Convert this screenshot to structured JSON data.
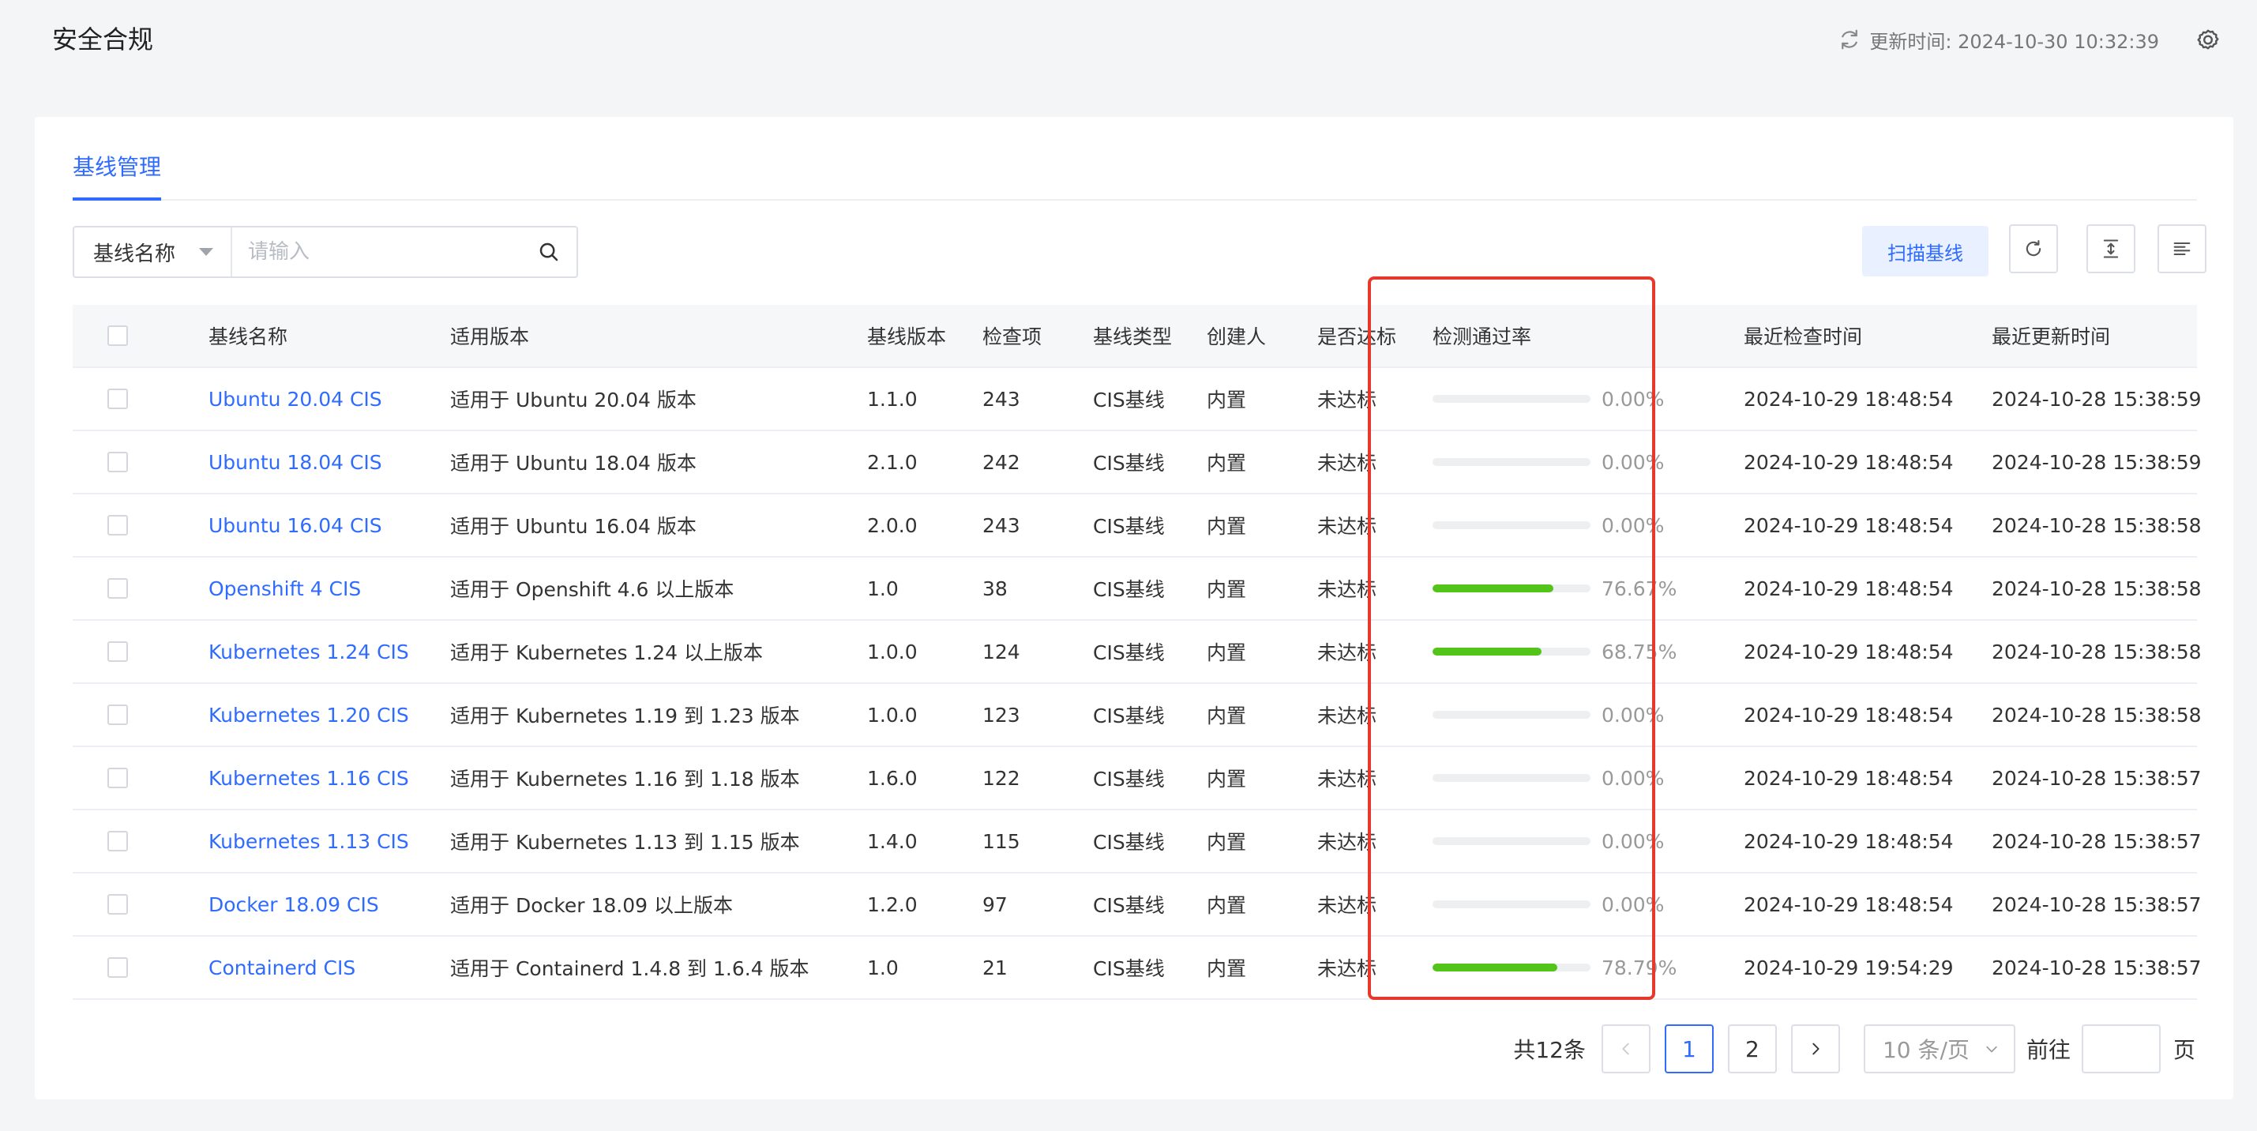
{
  "header": {
    "title": "安全合规",
    "update_time": "更新时间: 2024-10-30 10:32:39"
  },
  "tabs": [
    {
      "label": "基线管理",
      "active": true
    }
  ],
  "search": {
    "field": "基线名称",
    "placeholder": "请输入"
  },
  "toolbar": {
    "scan_label": "扫描基线"
  },
  "colors": {
    "accent": "#2f6bff",
    "progress": "#52c41a",
    "highlight": "#e8382c"
  },
  "table": {
    "columns": [
      "基线名称",
      "适用版本",
      "基线版本",
      "检查项",
      "基线类型",
      "创建人",
      "是否达标",
      "检测通过率",
      "最近检查时间",
      "最近更新时间"
    ],
    "rows": [
      {
        "name": "Ubuntu 20.04 CIS",
        "version": "适用于 Ubuntu 20.04 版本",
        "baseline_version": "1.1.0",
        "items": "243",
        "type": "CIS基线",
        "creator": "内置",
        "compliant": "未达标",
        "pass_rate": "0.00%",
        "pass_rate_value": 0.0,
        "last_check": "2024-10-29 18:48:54",
        "last_update": "2024-10-28 15:38:59"
      },
      {
        "name": "Ubuntu 18.04 CIS",
        "version": "适用于 Ubuntu 18.04 版本",
        "baseline_version": "2.1.0",
        "items": "242",
        "type": "CIS基线",
        "creator": "内置",
        "compliant": "未达标",
        "pass_rate": "0.00%",
        "pass_rate_value": 0.0,
        "last_check": "2024-10-29 18:48:54",
        "last_update": "2024-10-28 15:38:59"
      },
      {
        "name": "Ubuntu 16.04 CIS",
        "version": "适用于 Ubuntu 16.04 版本",
        "baseline_version": "2.0.0",
        "items": "243",
        "type": "CIS基线",
        "creator": "内置",
        "compliant": "未达标",
        "pass_rate": "0.00%",
        "pass_rate_value": 0.0,
        "last_check": "2024-10-29 18:48:54",
        "last_update": "2024-10-28 15:38:58"
      },
      {
        "name": "Openshift 4 CIS",
        "version": "适用于 Openshift 4.6 以上版本",
        "baseline_version": "1.0",
        "items": "38",
        "type": "CIS基线",
        "creator": "内置",
        "compliant": "未达标",
        "pass_rate": "76.67%",
        "pass_rate_value": 76.67,
        "last_check": "2024-10-29 18:48:54",
        "last_update": "2024-10-28 15:38:58"
      },
      {
        "name": "Kubernetes 1.24 CIS",
        "version": "适用于 Kubernetes 1.24 以上版本",
        "baseline_version": "1.0.0",
        "items": "124",
        "type": "CIS基线",
        "creator": "内置",
        "compliant": "未达标",
        "pass_rate": "68.75%",
        "pass_rate_value": 68.75,
        "last_check": "2024-10-29 18:48:54",
        "last_update": "2024-10-28 15:38:58"
      },
      {
        "name": "Kubernetes 1.20 CIS",
        "version": "适用于 Kubernetes 1.19 到 1.23 版本",
        "baseline_version": "1.0.0",
        "items": "123",
        "type": "CIS基线",
        "creator": "内置",
        "compliant": "未达标",
        "pass_rate": "0.00%",
        "pass_rate_value": 0.0,
        "last_check": "2024-10-29 18:48:54",
        "last_update": "2024-10-28 15:38:58"
      },
      {
        "name": "Kubernetes 1.16 CIS",
        "version": "适用于 Kubernetes 1.16 到 1.18 版本",
        "baseline_version": "1.6.0",
        "items": "122",
        "type": "CIS基线",
        "creator": "内置",
        "compliant": "未达标",
        "pass_rate": "0.00%",
        "pass_rate_value": 0.0,
        "last_check": "2024-10-29 18:48:54",
        "last_update": "2024-10-28 15:38:57"
      },
      {
        "name": "Kubernetes 1.13 CIS",
        "version": "适用于 Kubernetes 1.13 到 1.15 版本",
        "baseline_version": "1.4.0",
        "items": "115",
        "type": "CIS基线",
        "creator": "内置",
        "compliant": "未达标",
        "pass_rate": "0.00%",
        "pass_rate_value": 0.0,
        "last_check": "2024-10-29 18:48:54",
        "last_update": "2024-10-28 15:38:57"
      },
      {
        "name": "Docker 18.09 CIS",
        "version": "适用于 Docker 18.09 以上版本",
        "baseline_version": "1.2.0",
        "items": "97",
        "type": "CIS基线",
        "creator": "内置",
        "compliant": "未达标",
        "pass_rate": "0.00%",
        "pass_rate_value": 0.0,
        "last_check": "2024-10-29 18:48:54",
        "last_update": "2024-10-28 15:38:57"
      },
      {
        "name": "Containerd CIS",
        "version": "适用于 Containerd 1.4.8 到 1.6.4 版本",
        "baseline_version": "1.0",
        "items": "21",
        "type": "CIS基线",
        "creator": "内置",
        "compliant": "未达标",
        "pass_rate": "78.79%",
        "pass_rate_value": 78.79,
        "last_check": "2024-10-29 19:54:29",
        "last_update": "2024-10-28 15:38:57"
      }
    ]
  },
  "pagination": {
    "total": "共12条",
    "pages": [
      "1",
      "2"
    ],
    "current": "1",
    "page_size": "10 条/页",
    "goto_label": "前往",
    "page_label": "页"
  }
}
